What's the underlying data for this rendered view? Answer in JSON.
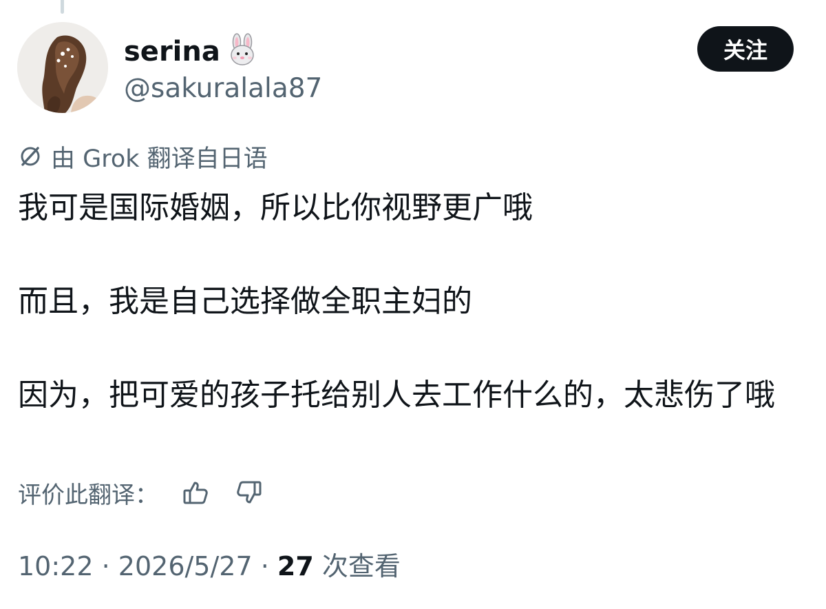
{
  "author": {
    "display_name": "serina",
    "handle": "@sakuralala87",
    "badge_icon": "rabbit-face-icon"
  },
  "follow_button": {
    "label": "关注"
  },
  "translation": {
    "icon": "grok-icon",
    "label": "由 Grok 翻译自日语",
    "rate_prompt": "评价此翻译：",
    "thumbs_up_icon": "thumbs-up-icon",
    "thumbs_down_icon": "thumbs-down-icon"
  },
  "post": {
    "paragraphs": [
      "我可是国际婚姻，所以比你视野更广哦",
      "而且，我是自己选择做全职主妇的",
      "因为，把可爱的孩子托给别人去工作什么的，太悲伤了哦"
    ]
  },
  "meta": {
    "time": "10:22",
    "date": "2026/5/27",
    "separator": "·",
    "views_count": "27",
    "views_label": "次查看"
  },
  "colors": {
    "text_primary": "#0f1419",
    "text_secondary": "#536471",
    "button_bg": "#0f1419",
    "button_text": "#ffffff",
    "thread_line": "#cfd9de"
  }
}
